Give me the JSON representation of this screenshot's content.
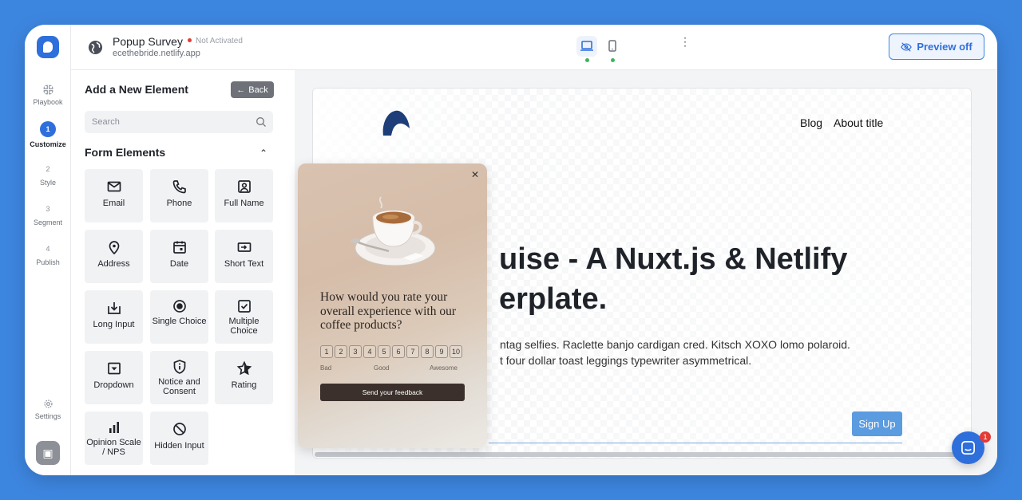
{
  "app": {
    "title": "Popup Survey",
    "status": "Not Activated",
    "subtitle": "ecethebride.netlify.app",
    "preview_label": "Preview off"
  },
  "rail": {
    "steps": [
      {
        "num": "",
        "label": "Playbook"
      },
      {
        "num": "1",
        "label": "Customize"
      },
      {
        "num": "2",
        "label": "Style"
      },
      {
        "num": "3",
        "label": "Segment"
      },
      {
        "num": "4",
        "label": "Publish"
      }
    ],
    "settings_label": "Settings"
  },
  "panel": {
    "title": "Add a New Element",
    "back_label": "Back",
    "search_placeholder": "Search",
    "section_title": "Form Elements",
    "elements": [
      {
        "label": "Email",
        "icon": "mail-icon"
      },
      {
        "label": "Phone",
        "icon": "phone-icon"
      },
      {
        "label": "Full Name",
        "icon": "user-icon"
      },
      {
        "label": "Address",
        "icon": "pin-icon"
      },
      {
        "label": "Date",
        "icon": "calendar-icon"
      },
      {
        "label": "Short Text",
        "icon": "input-icon"
      },
      {
        "label": "Long Input",
        "icon": "download-box-icon"
      },
      {
        "label": "Single Choice",
        "icon": "radio-icon"
      },
      {
        "label": "Multiple Choice",
        "icon": "checkbox-icon"
      },
      {
        "label": "Dropdown",
        "icon": "dropdown-icon"
      },
      {
        "label": "Notice and Consent",
        "icon": "shield-info-icon"
      },
      {
        "label": "Rating",
        "icon": "star-icon"
      },
      {
        "label": "Opinion Scale / NPS",
        "icon": "bar-chart-icon"
      },
      {
        "label": "Hidden Input",
        "icon": "hidden-icon"
      }
    ]
  },
  "site": {
    "nav": [
      "Blog",
      "About title"
    ],
    "hero_line1": "uise - A Nuxt.js & Netlify",
    "hero_line2": "erplate.",
    "para_line1": "ntag selfies. Raclette banjo cardigan cred. Kitsch XOXO lomo polaroid.",
    "para_line2": "t four dollar toast leggings typewriter asymmetrical.",
    "signup_label": "Sign Up"
  },
  "popup": {
    "question": "How would you rate your overall experience with our coffee products?",
    "scale": [
      "1",
      "2",
      "3",
      "4",
      "5",
      "6",
      "7",
      "8",
      "9",
      "10"
    ],
    "low_label": "Bad",
    "mid_label": "Good",
    "high_label": "Awesome",
    "button_label": "Send your feedback"
  },
  "chat": {
    "badge": "1"
  }
}
